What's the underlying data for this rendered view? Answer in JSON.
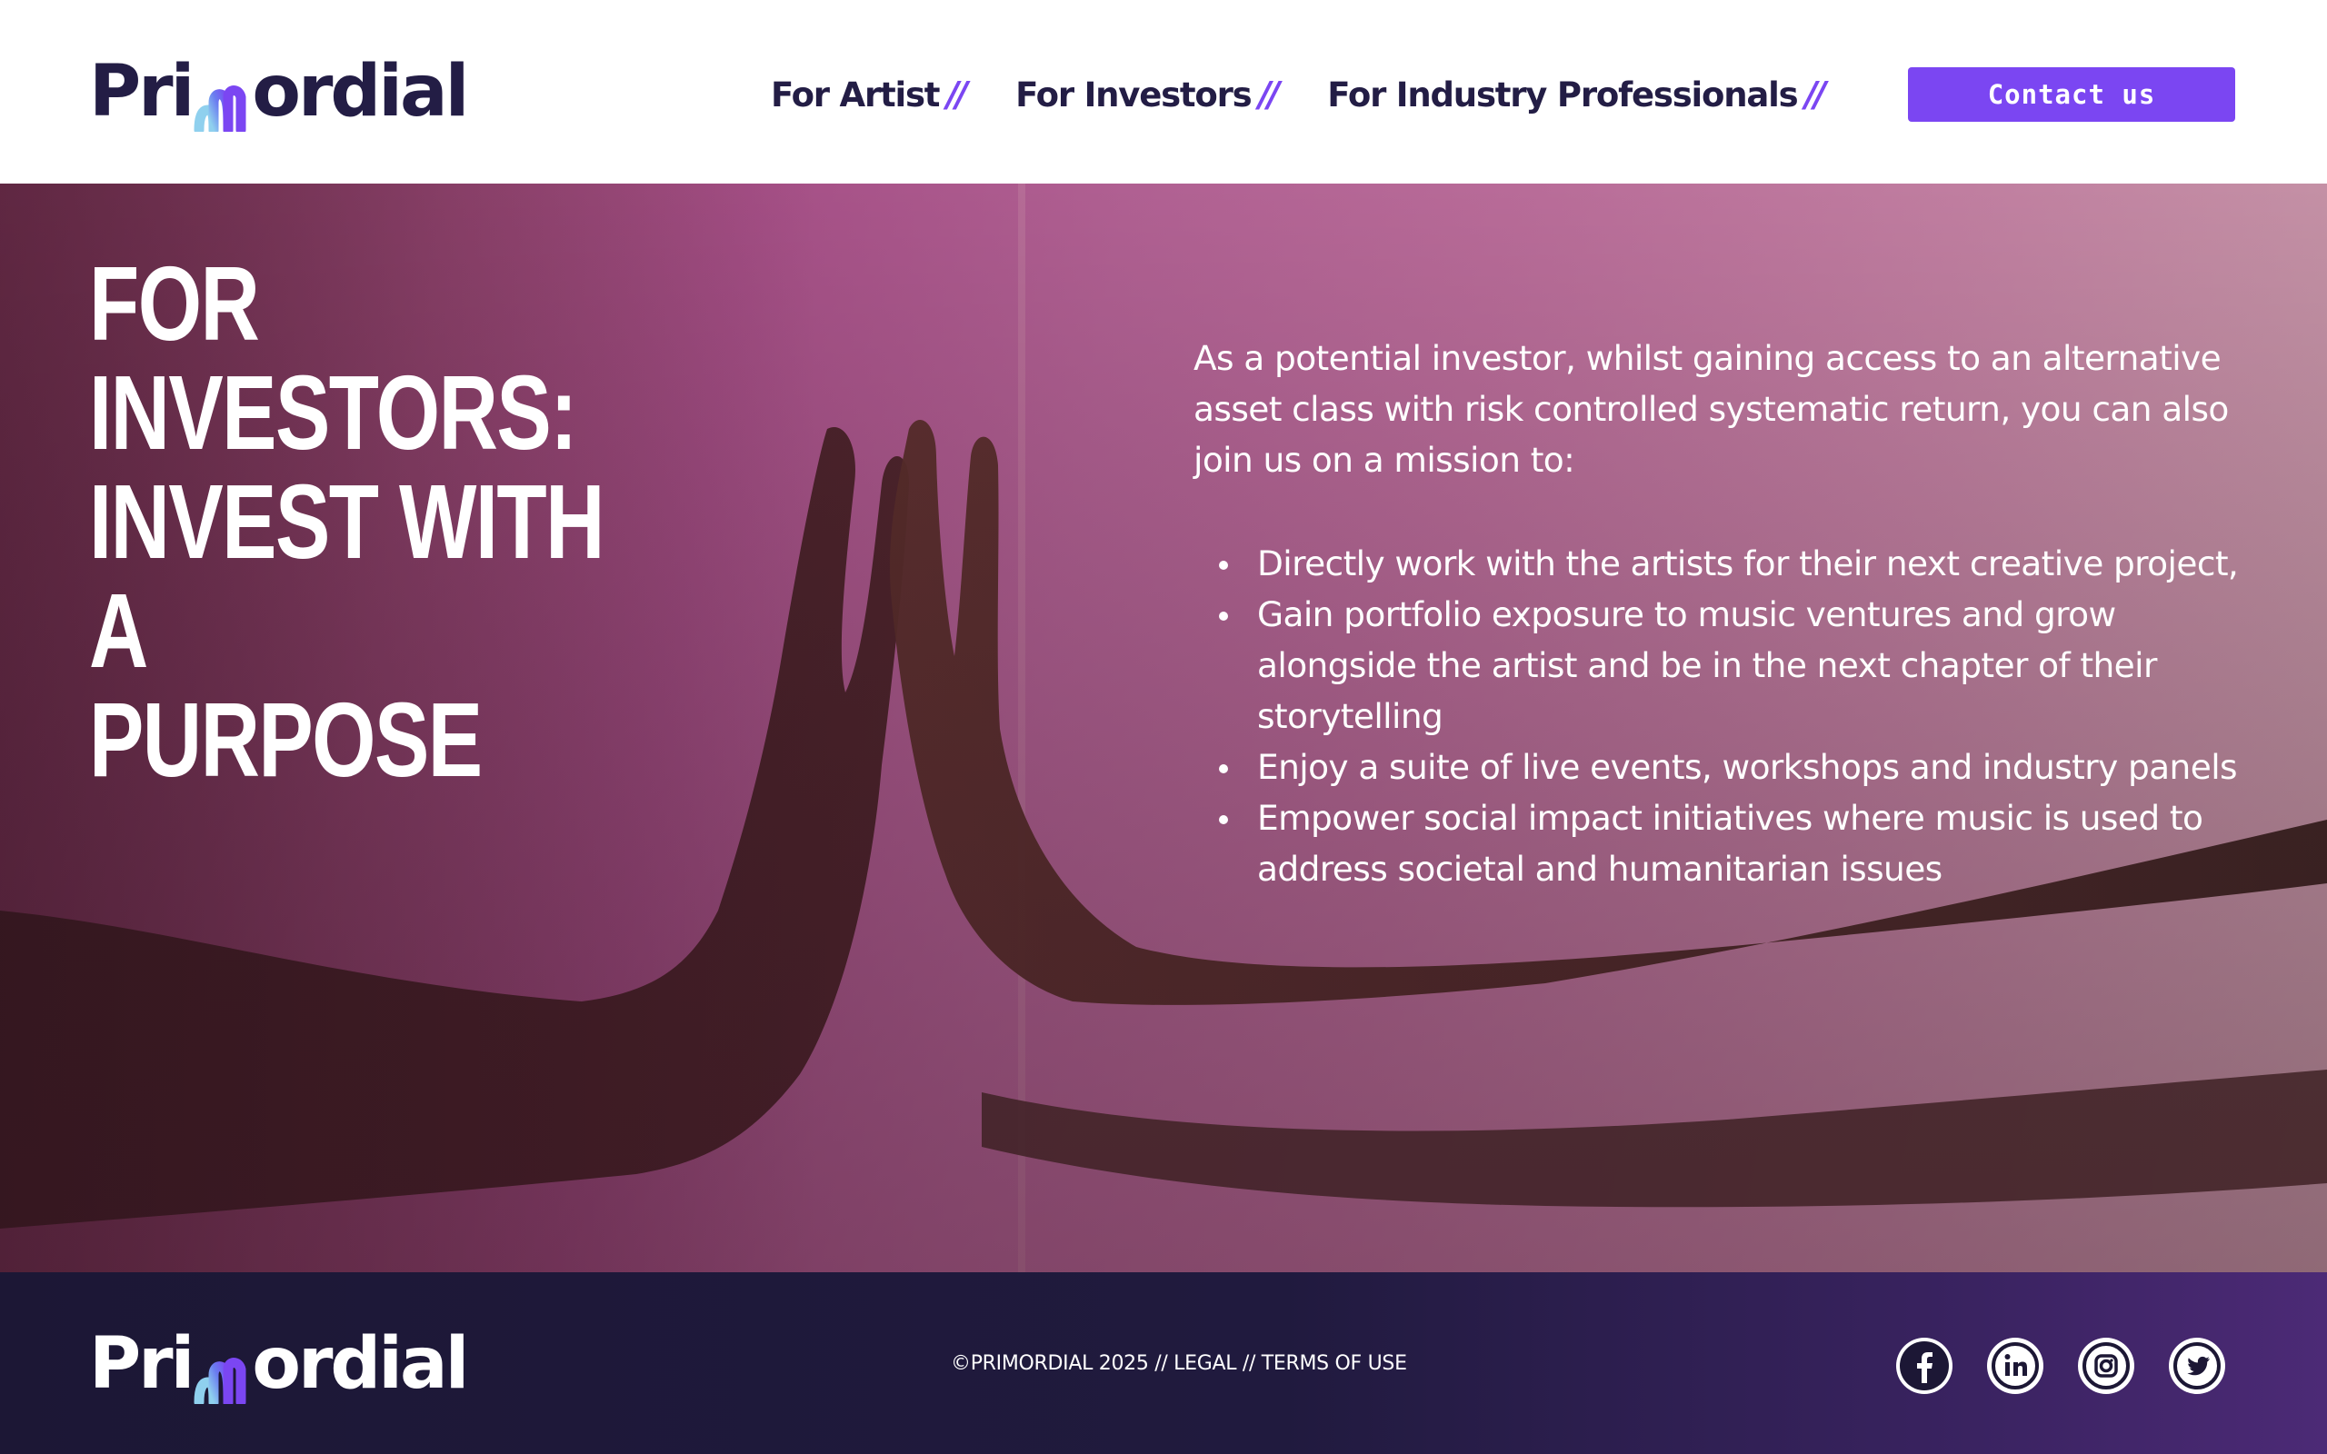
{
  "brand": {
    "logo_parts": [
      "Pri",
      "ordial"
    ],
    "logo_full": "Primordial",
    "colors": {
      "primary": "#7b46f2",
      "navy": "#231d45",
      "footer_bg": "#1c1735",
      "hero_accent": "#a54f86"
    }
  },
  "header": {
    "nav": [
      {
        "label": "For Artist",
        "slash": "//"
      },
      {
        "label": "For Investors",
        "slash": "//"
      },
      {
        "label": "For Industry Professionals",
        "slash": "//"
      }
    ],
    "contact_label": "Contact us"
  },
  "hero": {
    "title_lines": [
      "FOR INVESTORS:",
      "INVEST WITH A",
      "PURPOSE"
    ],
    "intro": "As a potential investor, whilst gaining access to an alternative asset class with risk controlled systematic return, you can also join us on a mission to:",
    "bullets": [
      "Directly work with the artists for their next creative project,",
      "Gain portfolio exposure to music ventures and grow alongside the artist and be in the next chapter of their storytelling",
      "Enjoy a suite of live events, workshops and industry panels",
      "Empower social impact initiatives where music is used to address societal and humanitarian issues"
    ],
    "image_subject": "two-hands-touching-mirror"
  },
  "footer": {
    "copyright": "©PRIMORDIAL 2025 // LEGAL // TERMS OF USE",
    "socials": [
      {
        "name": "facebook-icon"
      },
      {
        "name": "linkedin-icon"
      },
      {
        "name": "instagram-icon"
      },
      {
        "name": "twitter-icon"
      }
    ]
  }
}
